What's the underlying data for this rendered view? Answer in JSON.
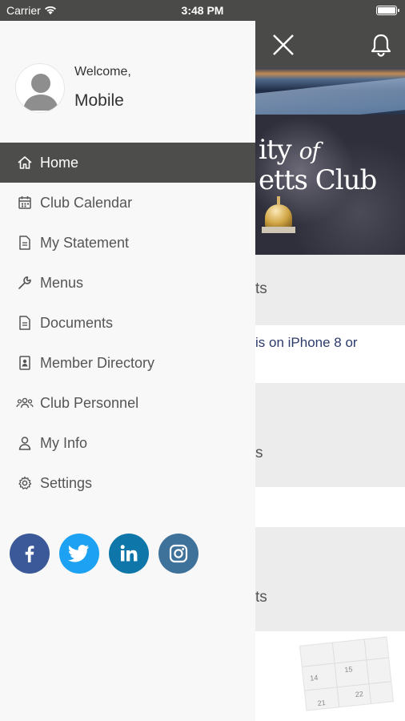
{
  "status_bar": {
    "carrier": "Carrier",
    "time": "3:48 PM"
  },
  "header": {
    "close_icon": "close-icon",
    "bell_icon": "bell-icon"
  },
  "hero": {
    "line1": "ity",
    "line1_italic": "of",
    "line2": "etts Club"
  },
  "background_sections": {
    "section1_text": "ts",
    "news_text": "is on iPhone 8 or",
    "section2_text": "s",
    "section3_text": "ts",
    "calendar_numbers": [
      "14",
      "15",
      "21",
      "22"
    ]
  },
  "profile": {
    "welcome": "Welcome,",
    "name": "Mobile"
  },
  "menu": {
    "items": [
      {
        "label": "Home",
        "icon": "home-icon",
        "active": true
      },
      {
        "label": "Club Calendar",
        "icon": "calendar-icon",
        "active": false
      },
      {
        "label": "My Statement",
        "icon": "document-icon",
        "active": false
      },
      {
        "label": "Menus",
        "icon": "wrench-icon",
        "active": false
      },
      {
        "label": "Documents",
        "icon": "document-icon",
        "active": false
      },
      {
        "label": "Member Directory",
        "icon": "contact-book-icon",
        "active": false
      },
      {
        "label": "Club Personnel",
        "icon": "group-icon",
        "active": false
      },
      {
        "label": "My Info",
        "icon": "person-icon",
        "active": false
      },
      {
        "label": "Settings",
        "icon": "gear-icon",
        "active": false
      }
    ]
  },
  "social": [
    {
      "name": "facebook-icon",
      "glyph": "f",
      "color": "#3b5998"
    },
    {
      "name": "twitter-icon",
      "glyph": "",
      "color": "#1da1f2"
    },
    {
      "name": "linkedin-icon",
      "glyph": "in",
      "color": "#0e76a8"
    },
    {
      "name": "instagram-icon",
      "glyph": "",
      "color": "#3f729b"
    }
  ],
  "colors": {
    "header_bg": "#4a4a48",
    "active_item_bg": "#4d4d4b",
    "drawer_bg": "#f8f8f8"
  }
}
